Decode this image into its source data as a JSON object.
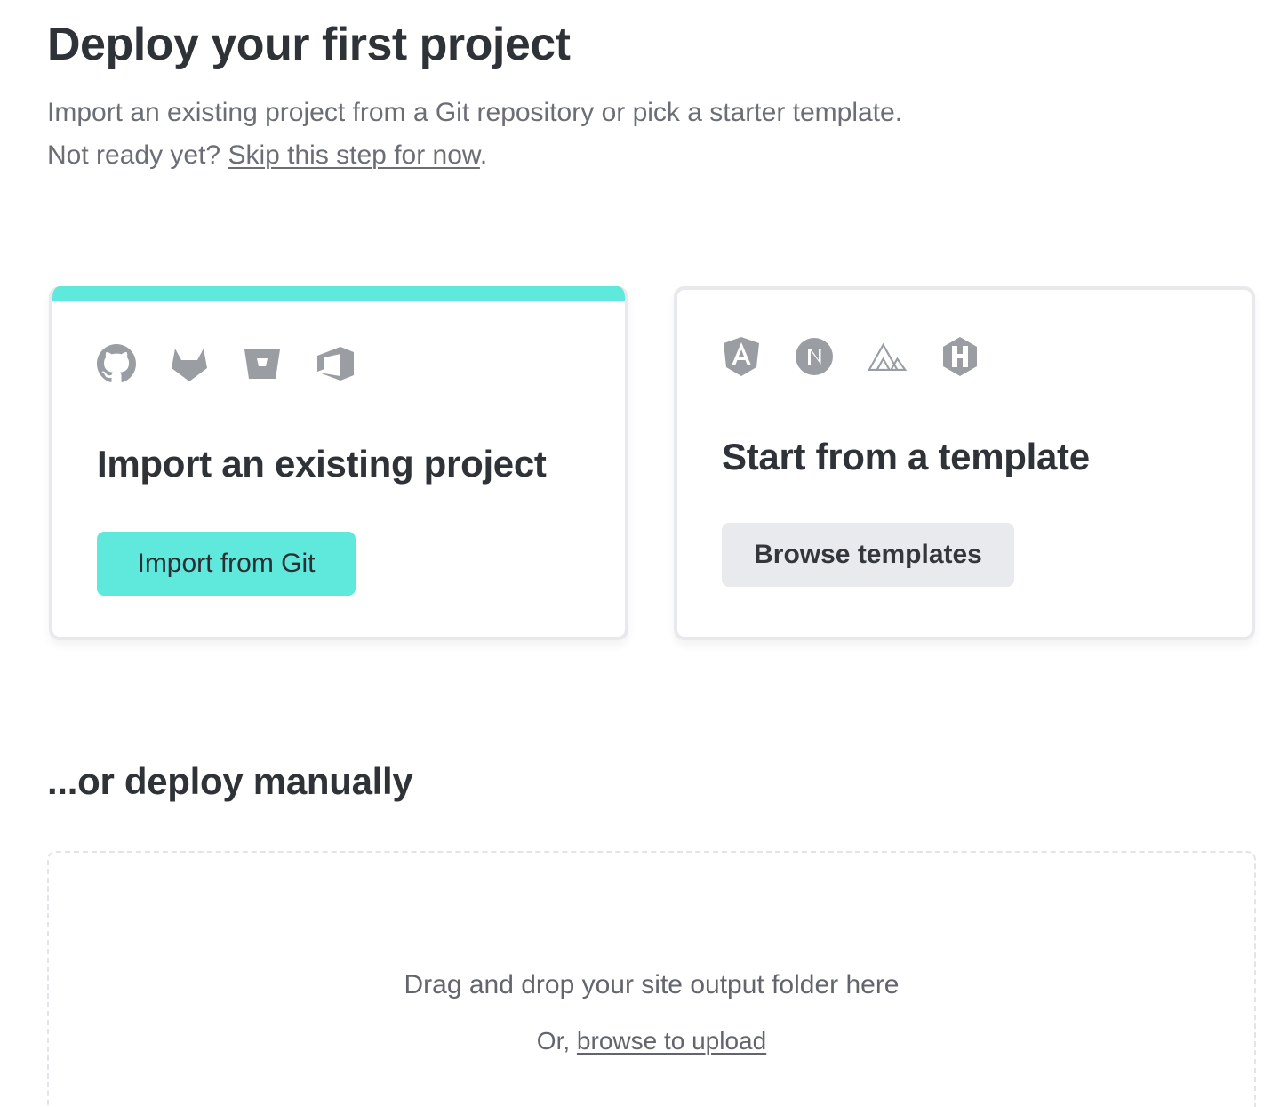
{
  "header": {
    "title": "Deploy your first project",
    "intro_line1": "Import an existing project from a Git repository or pick a starter template.",
    "intro_line2_prefix": "Not ready yet? ",
    "skip_link": "Skip this step for now",
    "intro_line2_suffix": "."
  },
  "import_card": {
    "icons": [
      "github-icon",
      "gitlab-icon",
      "bitbucket-icon",
      "azure-devops-icon"
    ],
    "heading": "Import an existing project",
    "button_label": "Import from Git",
    "accent_color": "#5ee9dc"
  },
  "template_card": {
    "icons": [
      "angular-icon",
      "nextjs-icon",
      "nuxt-icon",
      "hugo-icon"
    ],
    "heading": "Start from a template",
    "button_label": "Browse templates"
  },
  "manual": {
    "heading": "...or deploy manually",
    "dropzone_text": "Drag and drop your site output folder here",
    "dropzone_prefix": "Or, ",
    "browse_link": "browse to upload"
  }
}
